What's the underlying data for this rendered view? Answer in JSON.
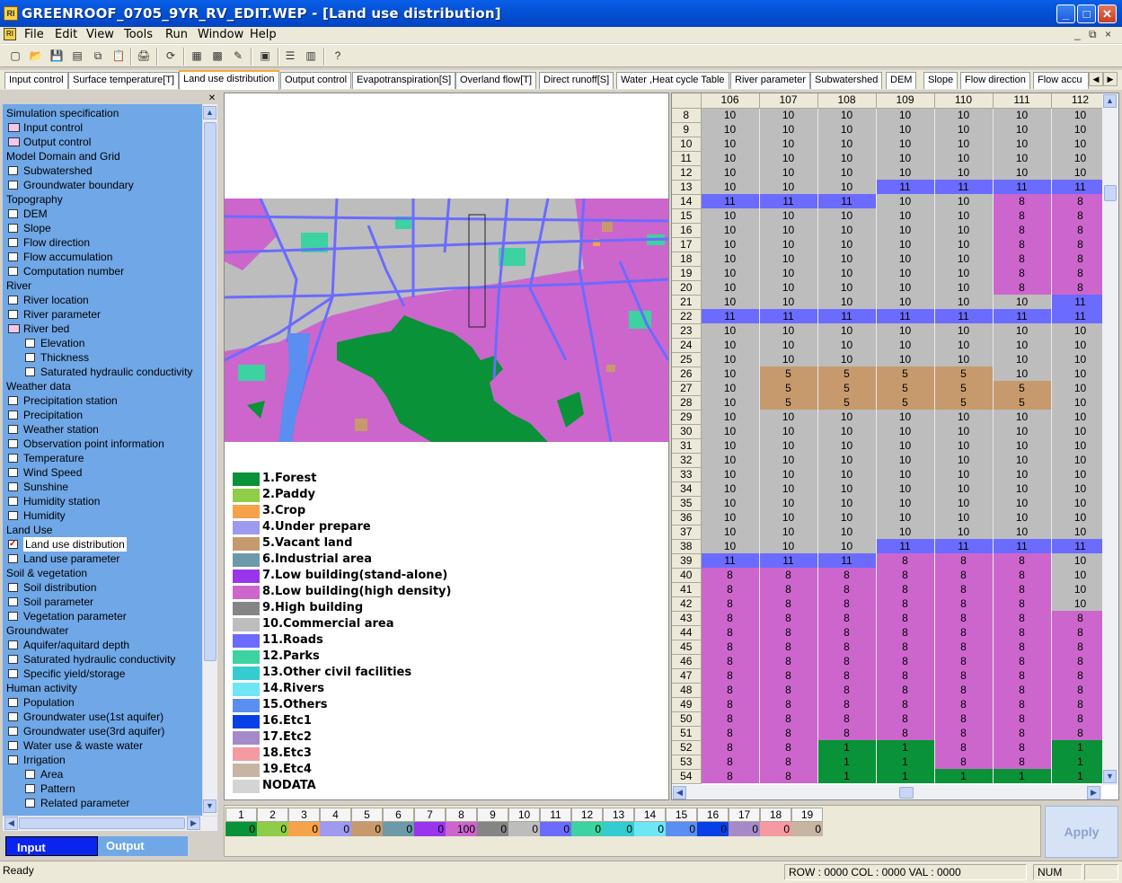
{
  "window": {
    "title": "GREENROOF_0705_9YR_RV_EDIT.WEP - [Land use distribution]",
    "app_icon_text": "RI",
    "min_glyph": "_",
    "max_glyph": "□",
    "close_glyph": "✕"
  },
  "menu": {
    "items": [
      "File",
      "Edit",
      "View",
      "Tools",
      "Run",
      "Window",
      "Help"
    ],
    "mdi": [
      "_",
      "⧉",
      "×"
    ]
  },
  "toolbar": {
    "icons": [
      "new-icon",
      "open-icon",
      "save-icon",
      "save-all-icon",
      "copy-icon",
      "paste-icon",
      "print-icon",
      "refresh-icon",
      "grid-icon",
      "image-icon",
      "edit-pen-icon",
      "export-icon",
      "layout-icon",
      "split-icon",
      "help-icon"
    ],
    "glyphs": [
      "▢",
      "📂",
      "💾",
      "▤",
      "⧉",
      "📋",
      "🖨",
      "⟳",
      "▦",
      "▩",
      "✎",
      "▣",
      "☰",
      "▥",
      "?"
    ]
  },
  "tabs": [
    "Input control",
    "Surface temperature[T]",
    "Land use distribution",
    "Output control",
    "Evapotranspiration[S]",
    "Overland flow[T]",
    "Direct runoff[S]",
    "Water ,Heat cycle Table",
    "River parameter",
    "Subwatershed",
    "DEM",
    "Slope",
    "Flow direction",
    "Flow accu"
  ],
  "active_tab": "Land use distribution",
  "tree": [
    {
      "label": "Simulation specification",
      "level": 0,
      "type": "group"
    },
    {
      "label": "Input control",
      "level": 1,
      "type": "folder"
    },
    {
      "label": "Output control",
      "level": 1,
      "type": "folder"
    },
    {
      "label": "Model Domain and Grid",
      "level": 0,
      "type": "group"
    },
    {
      "label": "Subwatershed",
      "level": 1,
      "type": "box"
    },
    {
      "label": "Groundwater boundary",
      "level": 1,
      "type": "box"
    },
    {
      "label": "Topography",
      "level": 0,
      "type": "group"
    },
    {
      "label": "DEM",
      "level": 1,
      "type": "box"
    },
    {
      "label": "Slope",
      "level": 1,
      "type": "box"
    },
    {
      "label": "Flow direction",
      "level": 1,
      "type": "box"
    },
    {
      "label": "Flow accumulation",
      "level": 1,
      "type": "box"
    },
    {
      "label": "Computation number",
      "level": 1,
      "type": "box"
    },
    {
      "label": "River",
      "level": 0,
      "type": "group"
    },
    {
      "label": "River location",
      "level": 1,
      "type": "box"
    },
    {
      "label": "River parameter",
      "level": 1,
      "type": "box"
    },
    {
      "label": "River bed",
      "level": 1,
      "type": "folder"
    },
    {
      "label": "Elevation",
      "level": 2,
      "type": "box"
    },
    {
      "label": "Thickness",
      "level": 2,
      "type": "box"
    },
    {
      "label": "Saturated hydraulic conductivity",
      "level": 2,
      "type": "box"
    },
    {
      "label": "Weather data",
      "level": 0,
      "type": "group"
    },
    {
      "label": "Precipitation station",
      "level": 1,
      "type": "box"
    },
    {
      "label": "Precipitation",
      "level": 1,
      "type": "box"
    },
    {
      "label": "Weather station",
      "level": 1,
      "type": "box"
    },
    {
      "label": "Observation point information",
      "level": 1,
      "type": "box"
    },
    {
      "label": "Temperature",
      "level": 1,
      "type": "box"
    },
    {
      "label": "Wind Speed",
      "level": 1,
      "type": "box"
    },
    {
      "label": "Sunshine",
      "level": 1,
      "type": "box"
    },
    {
      "label": "Humidity station",
      "level": 1,
      "type": "box"
    },
    {
      "label": "Humidity",
      "level": 1,
      "type": "box"
    },
    {
      "label": "Land Use",
      "level": 0,
      "type": "group"
    },
    {
      "label": "Land use distribution",
      "level": 1,
      "type": "checked"
    },
    {
      "label": "Land use parameter",
      "level": 1,
      "type": "box"
    },
    {
      "label": "Soil & vegetation",
      "level": 0,
      "type": "group"
    },
    {
      "label": "Soil distribution",
      "level": 1,
      "type": "box"
    },
    {
      "label": "Soil parameter",
      "level": 1,
      "type": "box"
    },
    {
      "label": "Vegetation parameter",
      "level": 1,
      "type": "box"
    },
    {
      "label": "Groundwater",
      "level": 0,
      "type": "group"
    },
    {
      "label": "Aquifer/aquitard depth",
      "level": 1,
      "type": "box"
    },
    {
      "label": "Saturated hydraulic conductivity",
      "level": 1,
      "type": "box"
    },
    {
      "label": "Specific yield/storage",
      "level": 1,
      "type": "box"
    },
    {
      "label": "Human activity",
      "level": 0,
      "type": "group"
    },
    {
      "label": "Population",
      "level": 1,
      "type": "box"
    },
    {
      "label": "Groundwater use(1st aquifer)",
      "level": 1,
      "type": "box"
    },
    {
      "label": "Groundwater use(3rd aquifer)",
      "level": 1,
      "type": "box"
    },
    {
      "label": "Water use & waste water",
      "level": 1,
      "type": "box"
    },
    {
      "label": "Irrigation",
      "level": 1,
      "type": "box"
    },
    {
      "label": "Area",
      "level": 2,
      "type": "box"
    },
    {
      "label": "Pattern",
      "level": 2,
      "type": "box"
    },
    {
      "label": "Related parameter",
      "level": 2,
      "type": "box"
    }
  ],
  "io_tabs": {
    "input": "Input",
    "output": "Output"
  },
  "legend": [
    {
      "label": "1.Forest",
      "color": "#0a9238"
    },
    {
      "label": "2.Paddy",
      "color": "#8fcc48"
    },
    {
      "label": "3.Crop",
      "color": "#f6a24a"
    },
    {
      "label": "4.Under prepare",
      "color": "#9e9af0"
    },
    {
      "label": "5.Vacant land",
      "color": "#c79a6e"
    },
    {
      "label": "6.Industrial area",
      "color": "#6d9aa8"
    },
    {
      "label": "7.Low building(stand-alone)",
      "color": "#9a35ee"
    },
    {
      "label": "8.Low building(high density)",
      "color": "#cc66cc"
    },
    {
      "label": "9.High building",
      "color": "#858585"
    },
    {
      "label": "10.Commercial area",
      "color": "#bdbdbd"
    },
    {
      "label": "11.Roads",
      "color": "#6b6bff"
    },
    {
      "label": "12.Parks",
      "color": "#3cd2a2"
    },
    {
      "label": "13.Other civil facilities",
      "color": "#34ccd0"
    },
    {
      "label": "14.Rivers",
      "color": "#6ee6f4"
    },
    {
      "label": "15.Others",
      "color": "#5a8ef0"
    },
    {
      "label": "16.Etc1",
      "color": "#0640e6"
    },
    {
      "label": "17.Etc2",
      "color": "#a68ac8"
    },
    {
      "label": "18.Etc3",
      "color": "#f49aa0"
    },
    {
      "label": "19.Etc4",
      "color": "#c8b4a2"
    },
    {
      "label": "NODATA",
      "color": "#d4d4d4"
    }
  ],
  "grid": {
    "columns": [
      "106",
      "107",
      "108",
      "109",
      "110",
      "111",
      "112"
    ],
    "rows": [
      {
        "r": "8",
        "v": [
          "10",
          "10",
          "10",
          "10",
          "10",
          "10",
          "10"
        ]
      },
      {
        "r": "9",
        "v": [
          "10",
          "10",
          "10",
          "10",
          "10",
          "10",
          "10"
        ]
      },
      {
        "r": "10",
        "v": [
          "10",
          "10",
          "10",
          "10",
          "10",
          "10",
          "10"
        ]
      },
      {
        "r": "11",
        "v": [
          "10",
          "10",
          "10",
          "10",
          "10",
          "10",
          "10"
        ]
      },
      {
        "r": "12",
        "v": [
          "10",
          "10",
          "10",
          "10",
          "10",
          "10",
          "10"
        ]
      },
      {
        "r": "13",
        "v": [
          "10",
          "10",
          "10",
          "11",
          "11",
          "11",
          "11"
        ]
      },
      {
        "r": "14",
        "v": [
          "11",
          "11",
          "11",
          "10",
          "10",
          "8",
          "8"
        ]
      },
      {
        "r": "15",
        "v": [
          "10",
          "10",
          "10",
          "10",
          "10",
          "8",
          "8"
        ]
      },
      {
        "r": "16",
        "v": [
          "10",
          "10",
          "10",
          "10",
          "10",
          "8",
          "8"
        ]
      },
      {
        "r": "17",
        "v": [
          "10",
          "10",
          "10",
          "10",
          "10",
          "8",
          "8"
        ]
      },
      {
        "r": "18",
        "v": [
          "10",
          "10",
          "10",
          "10",
          "10",
          "8",
          "8"
        ]
      },
      {
        "r": "19",
        "v": [
          "10",
          "10",
          "10",
          "10",
          "10",
          "8",
          "8"
        ]
      },
      {
        "r": "20",
        "v": [
          "10",
          "10",
          "10",
          "10",
          "10",
          "8",
          "8"
        ]
      },
      {
        "r": "21",
        "v": [
          "10",
          "10",
          "10",
          "10",
          "10",
          "10",
          "11"
        ]
      },
      {
        "r": "22",
        "v": [
          "11",
          "11",
          "11",
          "11",
          "11",
          "11",
          "11"
        ]
      },
      {
        "r": "23",
        "v": [
          "10",
          "10",
          "10",
          "10",
          "10",
          "10",
          "10"
        ]
      },
      {
        "r": "24",
        "v": [
          "10",
          "10",
          "10",
          "10",
          "10",
          "10",
          "10"
        ]
      },
      {
        "r": "25",
        "v": [
          "10",
          "10",
          "10",
          "10",
          "10",
          "10",
          "10"
        ]
      },
      {
        "r": "26",
        "v": [
          "10",
          "5",
          "5",
          "5",
          "5",
          "10",
          "10"
        ]
      },
      {
        "r": "27",
        "v": [
          "10",
          "5",
          "5",
          "5",
          "5",
          "5",
          "10"
        ]
      },
      {
        "r": "28",
        "v": [
          "10",
          "5",
          "5",
          "5",
          "5",
          "5",
          "10"
        ]
      },
      {
        "r": "29",
        "v": [
          "10",
          "10",
          "10",
          "10",
          "10",
          "10",
          "10"
        ]
      },
      {
        "r": "30",
        "v": [
          "10",
          "10",
          "10",
          "10",
          "10",
          "10",
          "10"
        ]
      },
      {
        "r": "31",
        "v": [
          "10",
          "10",
          "10",
          "10",
          "10",
          "10",
          "10"
        ]
      },
      {
        "r": "32",
        "v": [
          "10",
          "10",
          "10",
          "10",
          "10",
          "10",
          "10"
        ]
      },
      {
        "r": "33",
        "v": [
          "10",
          "10",
          "10",
          "10",
          "10",
          "10",
          "10"
        ]
      },
      {
        "r": "34",
        "v": [
          "10",
          "10",
          "10",
          "10",
          "10",
          "10",
          "10"
        ]
      },
      {
        "r": "35",
        "v": [
          "10",
          "10",
          "10",
          "10",
          "10",
          "10",
          "10"
        ]
      },
      {
        "r": "36",
        "v": [
          "10",
          "10",
          "10",
          "10",
          "10",
          "10",
          "10"
        ]
      },
      {
        "r": "37",
        "v": [
          "10",
          "10",
          "10",
          "10",
          "10",
          "10",
          "10"
        ]
      },
      {
        "r": "38",
        "v": [
          "10",
          "10",
          "10",
          "11",
          "11",
          "11",
          "11"
        ]
      },
      {
        "r": "39",
        "v": [
          "11",
          "11",
          "11",
          "8",
          "8",
          "8",
          "10"
        ]
      },
      {
        "r": "40",
        "v": [
          "8",
          "8",
          "8",
          "8",
          "8",
          "8",
          "10"
        ]
      },
      {
        "r": "41",
        "v": [
          "8",
          "8",
          "8",
          "8",
          "8",
          "8",
          "10"
        ]
      },
      {
        "r": "42",
        "v": [
          "8",
          "8",
          "8",
          "8",
          "8",
          "8",
          "10"
        ]
      },
      {
        "r": "43",
        "v": [
          "8",
          "8",
          "8",
          "8",
          "8",
          "8",
          "8"
        ]
      },
      {
        "r": "44",
        "v": [
          "8",
          "8",
          "8",
          "8",
          "8",
          "8",
          "8"
        ]
      },
      {
        "r": "45",
        "v": [
          "8",
          "8",
          "8",
          "8",
          "8",
          "8",
          "8"
        ]
      },
      {
        "r": "46",
        "v": [
          "8",
          "8",
          "8",
          "8",
          "8",
          "8",
          "8"
        ]
      },
      {
        "r": "47",
        "v": [
          "8",
          "8",
          "8",
          "8",
          "8",
          "8",
          "8"
        ]
      },
      {
        "r": "48",
        "v": [
          "8",
          "8",
          "8",
          "8",
          "8",
          "8",
          "8"
        ]
      },
      {
        "r": "49",
        "v": [
          "8",
          "8",
          "8",
          "8",
          "8",
          "8",
          "8"
        ]
      },
      {
        "r": "50",
        "v": [
          "8",
          "8",
          "8",
          "8",
          "8",
          "8",
          "8"
        ]
      },
      {
        "r": "51",
        "v": [
          "8",
          "8",
          "8",
          "8",
          "8",
          "8",
          "8"
        ]
      },
      {
        "r": "52",
        "v": [
          "8",
          "8",
          "1",
          "1",
          "8",
          "8",
          "1"
        ]
      },
      {
        "r": "53",
        "v": [
          "8",
          "8",
          "1",
          "1",
          "8",
          "8",
          "1"
        ]
      },
      {
        "r": "54",
        "v": [
          "8",
          "8",
          "1",
          "1",
          "1",
          "1",
          "1"
        ]
      }
    ]
  },
  "class_bar": [
    {
      "n": "1",
      "v": "0"
    },
    {
      "n": "2",
      "v": "0"
    },
    {
      "n": "3",
      "v": "0"
    },
    {
      "n": "4",
      "v": "0"
    },
    {
      "n": "5",
      "v": "0"
    },
    {
      "n": "6",
      "v": "0"
    },
    {
      "n": "7",
      "v": "0"
    },
    {
      "n": "8",
      "v": "100"
    },
    {
      "n": "9",
      "v": "0"
    },
    {
      "n": "10",
      "v": "0"
    },
    {
      "n": "11",
      "v": "0"
    },
    {
      "n": "12",
      "v": "0"
    },
    {
      "n": "13",
      "v": "0"
    },
    {
      "n": "14",
      "v": "0"
    },
    {
      "n": "15",
      "v": "0"
    },
    {
      "n": "16",
      "v": "0"
    },
    {
      "n": "17",
      "v": "0"
    },
    {
      "n": "18",
      "v": "0"
    },
    {
      "n": "19",
      "v": "0"
    }
  ],
  "apply_label": "Apply",
  "status": {
    "ready": "Ready",
    "pos": "ROW : 0000  COL : 0000  VAL : 0000",
    "num": "NUM"
  }
}
